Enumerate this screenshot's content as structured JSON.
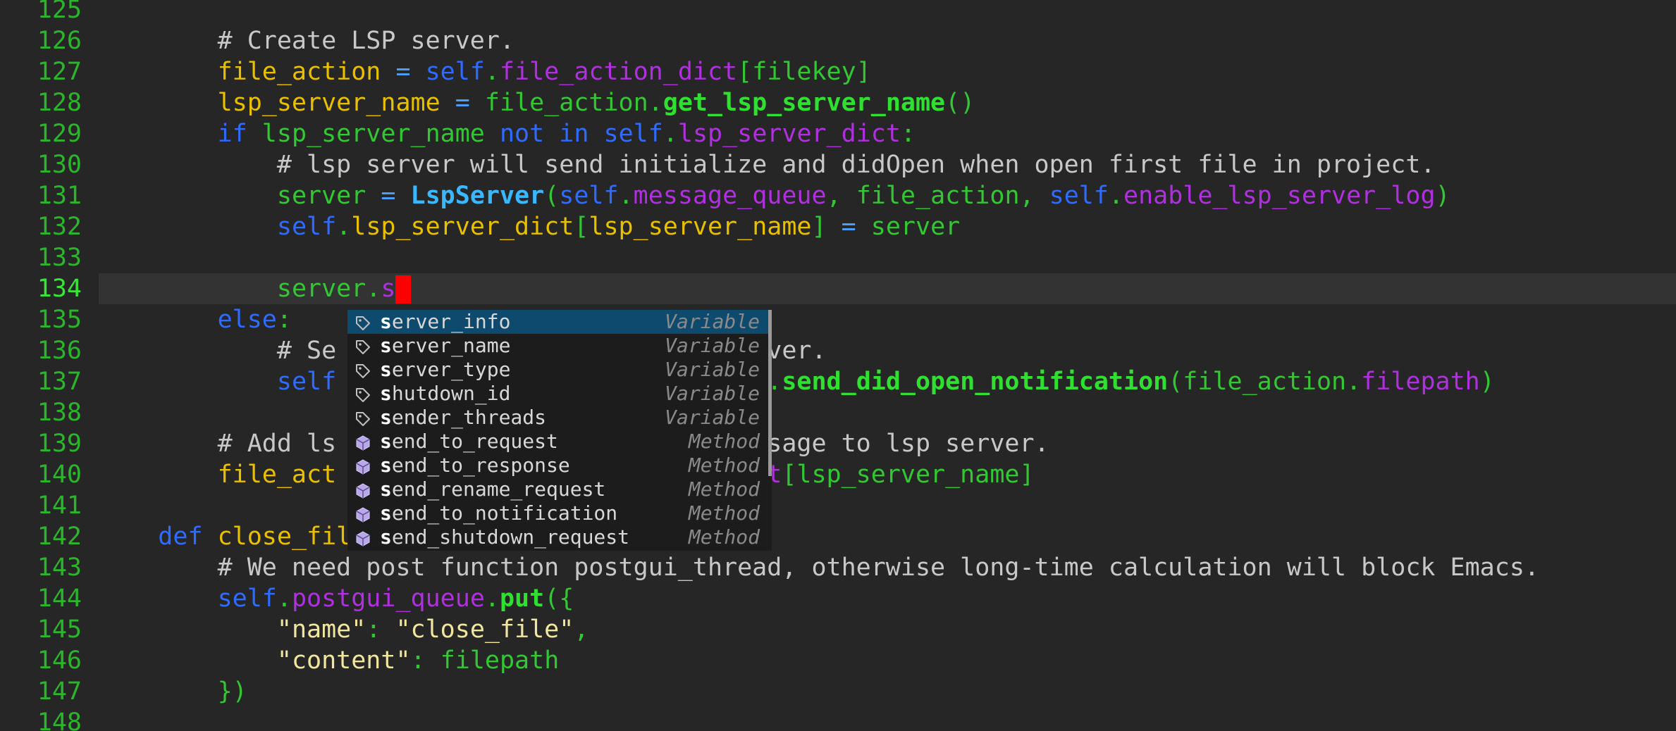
{
  "editor": {
    "current_line": "134",
    "lines": [
      {
        "num": "125",
        "segments": []
      },
      {
        "num": "126",
        "segments": [
          {
            "t": "        ",
            "c": "t-plain"
          },
          {
            "t": "# Create LSP server.",
            "c": "t-comment"
          }
        ]
      },
      {
        "num": "127",
        "segments": [
          {
            "t": "        ",
            "c": "t-plain"
          },
          {
            "t": "file_action",
            "c": "t-var"
          },
          {
            "t": " = ",
            "c": "t-op"
          },
          {
            "t": "self",
            "c": "t-self"
          },
          {
            "t": ".",
            "c": "t-punct"
          },
          {
            "t": "file_action_dict",
            "c": "t-attr"
          },
          {
            "t": "[",
            "c": "t-punct"
          },
          {
            "t": "filekey",
            "c": "t-name"
          },
          {
            "t": "]",
            "c": "t-punct"
          }
        ]
      },
      {
        "num": "128",
        "segments": [
          {
            "t": "        ",
            "c": "t-plain"
          },
          {
            "t": "lsp_server_name",
            "c": "t-var"
          },
          {
            "t": " = ",
            "c": "t-op"
          },
          {
            "t": "file_action",
            "c": "t-name"
          },
          {
            "t": ".",
            "c": "t-punct"
          },
          {
            "t": "get_lsp_server_name",
            "c": "t-fn"
          },
          {
            "t": "()",
            "c": "t-punct"
          }
        ]
      },
      {
        "num": "129",
        "segments": [
          {
            "t": "        ",
            "c": "t-plain"
          },
          {
            "t": "if",
            "c": "t-kw"
          },
          {
            "t": " lsp_server_name ",
            "c": "t-name"
          },
          {
            "t": "not",
            "c": "t-kw"
          },
          {
            "t": " ",
            "c": "t-plain"
          },
          {
            "t": "in",
            "c": "t-kw"
          },
          {
            "t": " ",
            "c": "t-plain"
          },
          {
            "t": "self",
            "c": "t-self"
          },
          {
            "t": ".",
            "c": "t-punct"
          },
          {
            "t": "lsp_server_dict",
            "c": "t-attr"
          },
          {
            "t": ":",
            "c": "t-punct"
          }
        ]
      },
      {
        "num": "130",
        "segments": [
          {
            "t": "            ",
            "c": "t-plain"
          },
          {
            "t": "# lsp server will send initialize and didOpen when open first file in project.",
            "c": "t-comment"
          }
        ]
      },
      {
        "num": "131",
        "segments": [
          {
            "t": "            ",
            "c": "t-plain"
          },
          {
            "t": "server",
            "c": "t-name"
          },
          {
            "t": " = ",
            "c": "t-op"
          },
          {
            "t": "LspServer",
            "c": "t-class"
          },
          {
            "t": "(",
            "c": "t-punct"
          },
          {
            "t": "self",
            "c": "t-self"
          },
          {
            "t": ".",
            "c": "t-punct"
          },
          {
            "t": "message_queue",
            "c": "t-attr"
          },
          {
            "t": ", file_action, ",
            "c": "t-name"
          },
          {
            "t": "self",
            "c": "t-self"
          },
          {
            "t": ".",
            "c": "t-punct"
          },
          {
            "t": "enable_lsp_server_log",
            "c": "t-attr"
          },
          {
            "t": ")",
            "c": "t-punct"
          }
        ]
      },
      {
        "num": "132",
        "segments": [
          {
            "t": "            ",
            "c": "t-plain"
          },
          {
            "t": "self",
            "c": "t-self"
          },
          {
            "t": ".",
            "c": "t-punct"
          },
          {
            "t": "lsp_server_dict",
            "c": "t-var"
          },
          {
            "t": "[",
            "c": "t-punct"
          },
          {
            "t": "lsp_server_name",
            "c": "t-var"
          },
          {
            "t": "]",
            "c": "t-punct"
          },
          {
            "t": " = ",
            "c": "t-op"
          },
          {
            "t": "server",
            "c": "t-name"
          }
        ]
      },
      {
        "num": "133",
        "segments": []
      },
      {
        "num": "134",
        "segments": [
          {
            "t": "            ",
            "c": "t-plain"
          },
          {
            "t": "server",
            "c": "t-name"
          },
          {
            "t": ".",
            "c": "t-punct"
          },
          {
            "t": "s",
            "c": "t-attr"
          }
        ],
        "cursor": true
      },
      {
        "num": "135",
        "segments": [
          {
            "t": "        ",
            "c": "t-plain"
          },
          {
            "t": "else",
            "c": "t-kw"
          },
          {
            "t": ":",
            "c": "t-punct"
          }
        ]
      },
      {
        "num": "136",
        "segments": [
          {
            "t": "            ",
            "c": "t-plain"
          },
          {
            "t": "# Se",
            "c": "t-comment"
          },
          {
            "t": "                      ",
            "c": "t-plain"
          },
          {
            "t": "LSP server.",
            "c": "t-comment"
          }
        ]
      },
      {
        "num": "137",
        "segments": [
          {
            "t": "            ",
            "c": "t-plain"
          },
          {
            "t": "self",
            "c": "t-self"
          },
          {
            "t": "                       ",
            "c": "t-plain"
          },
          {
            "t": "_name",
            "c": "t-var"
          },
          {
            "t": "].",
            "c": "t-punct"
          },
          {
            "t": "send_did_open_notification",
            "c": "t-fn"
          },
          {
            "t": "(",
            "c": "t-punct"
          },
          {
            "t": "file_action",
            "c": "t-name"
          },
          {
            "t": ".",
            "c": "t-punct"
          },
          {
            "t": "filepath",
            "c": "t-attr"
          },
          {
            "t": ")",
            "c": "t-punct"
          }
        ]
      },
      {
        "num": "138",
        "segments": []
      },
      {
        "num": "139",
        "segments": [
          {
            "t": "        ",
            "c": "t-plain"
          },
          {
            "t": "# Add ls",
            "c": "t-comment"
          },
          {
            "t": "                     ",
            "c": "t-plain"
          },
          {
            "t": "send message to lsp server.",
            "c": "t-comment"
          }
        ]
      },
      {
        "num": "140",
        "segments": [
          {
            "t": "        ",
            "c": "t-plain"
          },
          {
            "t": "file_act",
            "c": "t-var"
          },
          {
            "t": "                    ",
            "c": "t-plain"
          },
          {
            "t": "erver_dict",
            "c": "t-attr"
          },
          {
            "t": "[",
            "c": "t-punct"
          },
          {
            "t": "lsp_server_name",
            "c": "t-name"
          },
          {
            "t": "]",
            "c": "t-punct"
          }
        ]
      },
      {
        "num": "141",
        "segments": []
      },
      {
        "num": "142",
        "segments": [
          {
            "t": "    ",
            "c": "t-plain"
          },
          {
            "t": "def",
            "c": "t-def"
          },
          {
            "t": " ",
            "c": "t-plain"
          },
          {
            "t": "close_fil",
            "c": "t-var"
          }
        ]
      },
      {
        "num": "143",
        "segments": [
          {
            "t": "        ",
            "c": "t-plain"
          },
          {
            "t": "# We need post function postgui_thread, otherwise long-time calculation will block Emacs.",
            "c": "t-comment"
          }
        ]
      },
      {
        "num": "144",
        "segments": [
          {
            "t": "        ",
            "c": "t-plain"
          },
          {
            "t": "self",
            "c": "t-self"
          },
          {
            "t": ".",
            "c": "t-punct"
          },
          {
            "t": "postgui_queue",
            "c": "t-attr"
          },
          {
            "t": ".",
            "c": "t-punct"
          },
          {
            "t": "put",
            "c": "t-fn"
          },
          {
            "t": "({",
            "c": "t-punct"
          }
        ]
      },
      {
        "num": "145",
        "segments": [
          {
            "t": "            ",
            "c": "t-plain"
          },
          {
            "t": "\"name\"",
            "c": "t-str"
          },
          {
            "t": ": ",
            "c": "t-punct"
          },
          {
            "t": "\"close_file\"",
            "c": "t-str"
          },
          {
            "t": ",",
            "c": "t-punct"
          }
        ]
      },
      {
        "num": "146",
        "segments": [
          {
            "t": "            ",
            "c": "t-plain"
          },
          {
            "t": "\"content\"",
            "c": "t-str"
          },
          {
            "t": ": ",
            "c": "t-punct"
          },
          {
            "t": "filepath",
            "c": "t-name"
          }
        ]
      },
      {
        "num": "147",
        "segments": [
          {
            "t": "        ",
            "c": "t-plain"
          },
          {
            "t": "})",
            "c": "t-punct"
          }
        ]
      },
      {
        "num": "148",
        "segments": []
      }
    ]
  },
  "completion": {
    "prefix": "s",
    "selected_index": 0,
    "items": [
      {
        "match": "s",
        "rest": "erver_info",
        "kind": "Variable",
        "icon": "tag-icon"
      },
      {
        "match": "s",
        "rest": "erver_name",
        "kind": "Variable",
        "icon": "tag-icon"
      },
      {
        "match": "s",
        "rest": "erver_type",
        "kind": "Variable",
        "icon": "tag-icon"
      },
      {
        "match": "s",
        "rest": "hutdown_id",
        "kind": "Variable",
        "icon": "tag-icon"
      },
      {
        "match": "s",
        "rest": "ender_threads",
        "kind": "Variable",
        "icon": "tag-icon"
      },
      {
        "match": "s",
        "rest": "end_to_request",
        "kind": "Method",
        "icon": "cube-icon"
      },
      {
        "match": "s",
        "rest": "end_to_response",
        "kind": "Method",
        "icon": "cube-icon"
      },
      {
        "match": "s",
        "rest": "end_rename_request",
        "kind": "Method",
        "icon": "cube-icon"
      },
      {
        "match": "s",
        "rest": "end_to_notification",
        "kind": "Method",
        "icon": "cube-icon"
      },
      {
        "match": "s",
        "rest": "end_shutdown_request",
        "kind": "Method",
        "icon": "cube-icon"
      }
    ]
  },
  "colors": {
    "background": "#262626",
    "current_line": "#333333",
    "cursor": "#ff0000",
    "popup_bg": "#1c1c1c",
    "popup_selected": "#0d4a6e"
  }
}
